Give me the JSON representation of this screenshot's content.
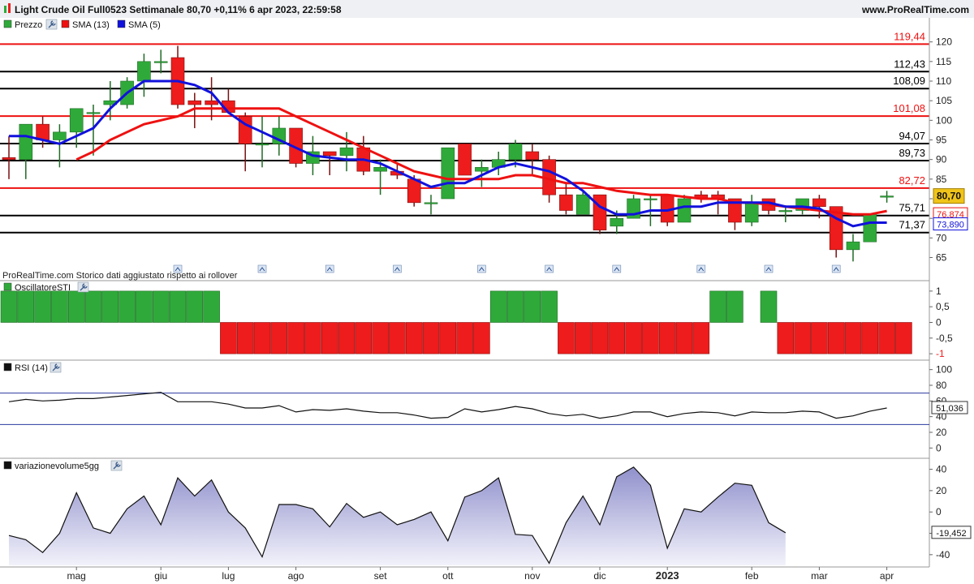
{
  "header": {
    "title": "Light Crude Oil Full0523 Settimanale 80,70 +0,11% 6 apr 2023, 22:59:58",
    "site": "www.ProRealTime.com"
  },
  "legend": {
    "price_label": "Prezzo",
    "sma13_label": "SMA (13)",
    "sma5_label": "SMA (5)"
  },
  "watermark": "ProRealTime.com  Storico dati aggiustato rispetto ai rollover",
  "panels": {
    "sti_label": "OscillatoreSTI",
    "rsi_label": "RSI (14)",
    "vol_label": "variazionevolume5gg"
  },
  "colors": {
    "up": "#2faa3a",
    "down": "#ee1c1c",
    "sma13": "#ee1111",
    "sma5": "#1111dd",
    "area_fill": "#c8c8e8"
  },
  "chart_data": [
    {
      "type": "candlestick",
      "name": "Prezzo",
      "ylim": [
        62,
        122
      ],
      "yticks": [
        65,
        70,
        75,
        80,
        85,
        90,
        95,
        100,
        105,
        110,
        115,
        120
      ],
      "xlabels": [
        {
          "i": 4,
          "label": "mag"
        },
        {
          "i": 9,
          "label": "giu"
        },
        {
          "i": 13,
          "label": "lug"
        },
        {
          "i": 17,
          "label": "ago"
        },
        {
          "i": 22,
          "label": "set"
        },
        {
          "i": 26,
          "label": "ott"
        },
        {
          "i": 31,
          "label": "nov"
        },
        {
          "i": 35,
          "label": "dic"
        },
        {
          "i": 39,
          "label": "2023"
        },
        {
          "i": 44,
          "label": "feb"
        },
        {
          "i": 48,
          "label": "mar"
        },
        {
          "i": 52,
          "label": "apr"
        }
      ],
      "candles": [
        {
          "o": 90.5,
          "h": 96,
          "l": 85,
          "c": 90
        },
        {
          "o": 90,
          "h": 99,
          "l": 85,
          "c": 99
        },
        {
          "o": 99,
          "h": 101,
          "l": 93,
          "c": 95
        },
        {
          "o": 95,
          "h": 99,
          "l": 88,
          "c": 97
        },
        {
          "o": 97,
          "h": 103,
          "l": 93,
          "c": 103
        },
        {
          "o": 102,
          "h": 104,
          "l": 91,
          "c": 102
        },
        {
          "o": 104,
          "h": 110,
          "l": 100,
          "c": 105
        },
        {
          "o": 104,
          "h": 111,
          "l": 103,
          "c": 110
        },
        {
          "o": 110,
          "h": 117,
          "l": 106,
          "c": 115
        },
        {
          "o": 115,
          "h": 118,
          "l": 112,
          "c": 115
        },
        {
          "o": 116,
          "h": 119,
          "l": 103,
          "c": 104
        },
        {
          "o": 105,
          "h": 107,
          "l": 98,
          "c": 104
        },
        {
          "o": 105,
          "h": 111,
          "l": 100,
          "c": 104
        },
        {
          "o": 105,
          "h": 108,
          "l": 102,
          "c": 102
        },
        {
          "o": 101,
          "h": 102,
          "l": 87,
          "c": 94
        },
        {
          "o": 94,
          "h": 101,
          "l": 88,
          "c": 94
        },
        {
          "o": 94,
          "h": 101,
          "l": 91,
          "c": 98
        },
        {
          "o": 98,
          "h": 98,
          "l": 88,
          "c": 89
        },
        {
          "o": 89,
          "h": 96,
          "l": 86,
          "c": 92
        },
        {
          "o": 92,
          "h": 92,
          "l": 86,
          "c": 91
        },
        {
          "o": 91,
          "h": 97,
          "l": 87,
          "c": 93
        },
        {
          "o": 93,
          "h": 96,
          "l": 86,
          "c": 87
        },
        {
          "o": 87,
          "h": 90,
          "l": 81,
          "c": 88
        },
        {
          "o": 87,
          "h": 89,
          "l": 85,
          "c": 86
        },
        {
          "o": 85,
          "h": 86,
          "l": 78,
          "c": 79
        },
        {
          "o": 79,
          "h": 81,
          "l": 76,
          "c": 79
        },
        {
          "o": 80,
          "h": 93,
          "l": 80,
          "c": 93
        },
        {
          "o": 94,
          "h": 94,
          "l": 86,
          "c": 86
        },
        {
          "o": 87,
          "h": 90,
          "l": 83,
          "c": 88
        },
        {
          "o": 88,
          "h": 92,
          "l": 86,
          "c": 90
        },
        {
          "o": 90,
          "h": 95,
          "l": 88,
          "c": 94
        },
        {
          "o": 92,
          "h": 94,
          "l": 86,
          "c": 90
        },
        {
          "o": 90,
          "h": 91,
          "l": 79,
          "c": 81
        },
        {
          "o": 81,
          "h": 84,
          "l": 76,
          "c": 77
        },
        {
          "o": 76,
          "h": 82,
          "l": 76,
          "c": 81
        },
        {
          "o": 81,
          "h": 81,
          "l": 71,
          "c": 72
        },
        {
          "o": 73,
          "h": 77,
          "l": 71,
          "c": 75
        },
        {
          "o": 75,
          "h": 81,
          "l": 75,
          "c": 80
        },
        {
          "o": 80,
          "h": 81,
          "l": 73,
          "c": 80
        },
        {
          "o": 81,
          "h": 81,
          "l": 73,
          "c": 74
        },
        {
          "o": 74,
          "h": 81,
          "l": 74,
          "c": 80
        },
        {
          "o": 81,
          "h": 82,
          "l": 79,
          "c": 80
        },
        {
          "o": 81,
          "h": 82,
          "l": 76,
          "c": 80
        },
        {
          "o": 80,
          "h": 80,
          "l": 72,
          "c": 74
        },
        {
          "o": 74,
          "h": 81,
          "l": 73,
          "c": 79
        },
        {
          "o": 80,
          "h": 80,
          "l": 76,
          "c": 77
        },
        {
          "o": 77,
          "h": 78,
          "l": 74,
          "c": 77
        },
        {
          "o": 77,
          "h": 80,
          "l": 76,
          "c": 80
        },
        {
          "o": 80,
          "h": 81,
          "l": 75,
          "c": 78
        },
        {
          "o": 78,
          "h": 78,
          "l": 65,
          "c": 67
        },
        {
          "o": 67,
          "h": 71,
          "l": 64,
          "c": 69
        },
        {
          "o": 69,
          "h": 76,
          "l": 69,
          "c": 76
        },
        {
          "o": 80.6,
          "h": 82,
          "l": 79,
          "c": 80.7
        }
      ],
      "sma13": [
        null,
        null,
        null,
        null,
        90,
        92,
        95,
        97,
        99,
        100,
        101,
        103,
        103,
        103,
        103,
        103,
        103,
        101,
        99,
        97,
        95,
        93,
        91,
        89,
        87,
        86,
        85,
        85,
        85,
        85,
        86,
        86,
        85,
        84,
        84,
        83,
        82,
        81.5,
        81,
        81,
        80.5,
        80,
        80,
        79,
        79,
        78.5,
        78,
        77.5,
        77,
        76.5,
        76,
        76,
        76.87
      ],
      "sma5": [
        96,
        96,
        95,
        94,
        96,
        98,
        103,
        107,
        110,
        110,
        110,
        109,
        107,
        102,
        99,
        97,
        95,
        93,
        91,
        90.5,
        90,
        90,
        89,
        87,
        85,
        83,
        84,
        84,
        86,
        88,
        89,
        88,
        87,
        85,
        82,
        78,
        76,
        76,
        77,
        77,
        78,
        78,
        79,
        79,
        79,
        79,
        78,
        78,
        77.5,
        75,
        73,
        73.89,
        73.89
      ],
      "hlines": [
        {
          "v": 119.44,
          "color": "#ee1111",
          "label": "119,44"
        },
        {
          "v": 112.43,
          "color": "#000000",
          "label": "112,43"
        },
        {
          "v": 108.09,
          "color": "#000000",
          "label": "108,09"
        },
        {
          "v": 101.08,
          "color": "#ee1111",
          "label": "101,08"
        },
        {
          "v": 94.07,
          "color": "#000000",
          "label": "94,07"
        },
        {
          "v": 89.73,
          "color": "#000000",
          "label": "89,73"
        },
        {
          "v": 82.72,
          "color": "#ee1111",
          "label": "82,72"
        },
        {
          "v": 75.71,
          "color": "#000000",
          "label": "75,71"
        },
        {
          "v": 71.37,
          "color": "#000000",
          "label": "71,37"
        }
      ],
      "last_values": {
        "price": "80,70",
        "sma13": "76,874",
        "sma5": "73,890"
      }
    },
    {
      "type": "bar",
      "name": "OscillatoreSTI",
      "ylim": [
        -1.1,
        1.1
      ],
      "yticks": [
        {
          "v": 1,
          "label": "1"
        },
        {
          "v": 0.5,
          "label": "0,5"
        },
        {
          "v": 0,
          "label": "0"
        },
        {
          "v": -0.5,
          "label": "-0,5"
        },
        {
          "v": -1,
          "label": "-1"
        }
      ],
      "values": [
        1,
        1,
        1,
        1,
        1,
        1,
        1,
        1,
        1,
        1,
        1,
        1,
        1,
        -1,
        -1,
        -1,
        -1,
        -1,
        -1,
        -1,
        -1,
        -1,
        -1,
        -1,
        -1,
        -1,
        -1,
        -1,
        -1,
        1,
        1,
        1,
        1,
        -1,
        -1,
        -1,
        -1,
        -1,
        -1,
        -1,
        -1,
        -1,
        1,
        1,
        0,
        1,
        -1,
        -1,
        -1,
        -1,
        -1,
        -1,
        -1,
        -1
      ]
    },
    {
      "type": "line",
      "name": "RSI (14)",
      "ylim": [
        -10,
        110
      ],
      "yticks": [
        100,
        80,
        60,
        40,
        20,
        0
      ],
      "levels": [
        70,
        30
      ],
      "values": [
        59,
        62,
        60,
        61,
        63,
        63,
        65,
        67,
        69,
        71,
        59,
        59,
        59,
        56,
        51,
        51,
        54,
        46,
        49,
        48,
        50,
        47,
        45,
        45,
        42,
        38,
        39,
        50,
        46,
        49,
        53,
        50,
        44,
        41,
        43,
        38,
        41,
        46,
        46,
        40,
        44,
        46,
        45,
        41,
        46,
        45,
        45,
        47,
        46,
        38,
        41,
        47,
        51.036
      ],
      "last_label": "51,036"
    },
    {
      "type": "area",
      "name": "variazionevolume5gg",
      "ylim": [
        -50,
        45
      ],
      "yticks": [
        40,
        20,
        0,
        -20,
        -40
      ],
      "values": [
        -22,
        -26,
        -38,
        -20,
        18,
        -15,
        -20,
        3,
        15,
        -12,
        32,
        15,
        30,
        0,
        -15,
        -42,
        7,
        7,
        3,
        -14,
        8,
        -5,
        0,
        -12,
        -7,
        0,
        -27,
        14,
        20,
        32,
        -21,
        -22,
        -48,
        -10,
        15,
        -12,
        33,
        42,
        25,
        -34,
        3,
        0,
        14,
        27,
        25,
        -10,
        -19.452
      ],
      "last_label": "-19,452",
      "x_offset": 6
    }
  ]
}
